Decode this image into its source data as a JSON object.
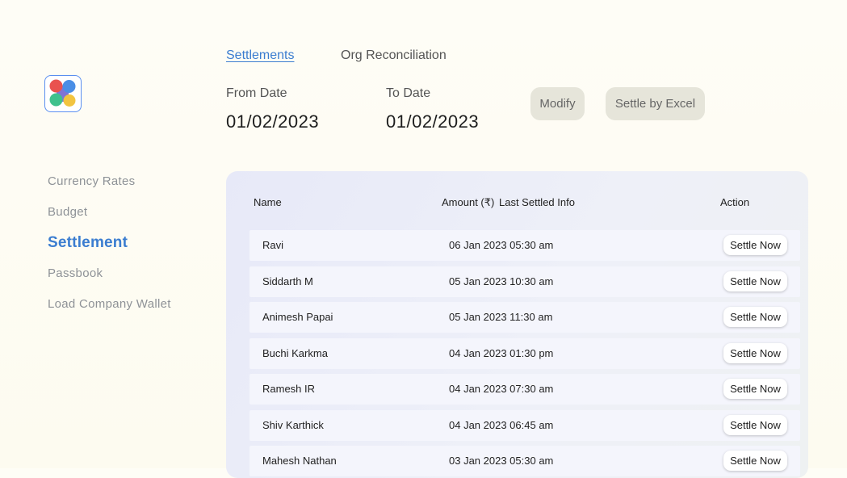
{
  "app": {
    "logo_icon": "four-dots-logo-icon",
    "logo_colors": [
      "#e9524f",
      "#4a8ee6",
      "#3fc18d",
      "#f2c440"
    ]
  },
  "sidebar": {
    "items": [
      {
        "label": "Currency Rates",
        "active": false
      },
      {
        "label": "Budget",
        "active": false
      },
      {
        "label": "Settlement",
        "active": true
      },
      {
        "label": "Passbook",
        "active": false
      },
      {
        "label": "Load Company Wallet",
        "active": false
      }
    ],
    "active_color": "#3b7dd0"
  },
  "tabs": [
    {
      "label": "Settlements",
      "active": true
    },
    {
      "label": "Org Reconciliation",
      "active": false
    }
  ],
  "filters": {
    "from_date_label": "From Date",
    "from_date_value": "01/02/2023",
    "to_date_label": "To Date",
    "to_date_value": "01/02/2023",
    "modify_label": "Modify",
    "settle_excel_label": "Settle by Excel"
  },
  "table": {
    "headers": {
      "name": "Name",
      "amount": "Amount (₹)",
      "last_settled": "Last Settled Info",
      "action": "Action"
    },
    "action_label": "Settle Now",
    "rows": [
      {
        "name": "Ravi",
        "last_settled": "06 Jan 2023 05:30 am"
      },
      {
        "name": "Siddarth M",
        "last_settled": "05 Jan 2023 10:30 am"
      },
      {
        "name": "Animesh Papai",
        "last_settled": "05 Jan 2023 11:30 am"
      },
      {
        "name": "Buchi Karkma",
        "last_settled": "04 Jan 2023 01:30 pm"
      },
      {
        "name": "Ramesh IR",
        "last_settled": "04 Jan 2023 07:30 am"
      },
      {
        "name": "Shiv Karthick",
        "last_settled": "04 Jan 2023 06:45 am"
      },
      {
        "name": "Mahesh Nathan",
        "last_settled": "03 Jan 2023 05:30 am"
      }
    ]
  }
}
